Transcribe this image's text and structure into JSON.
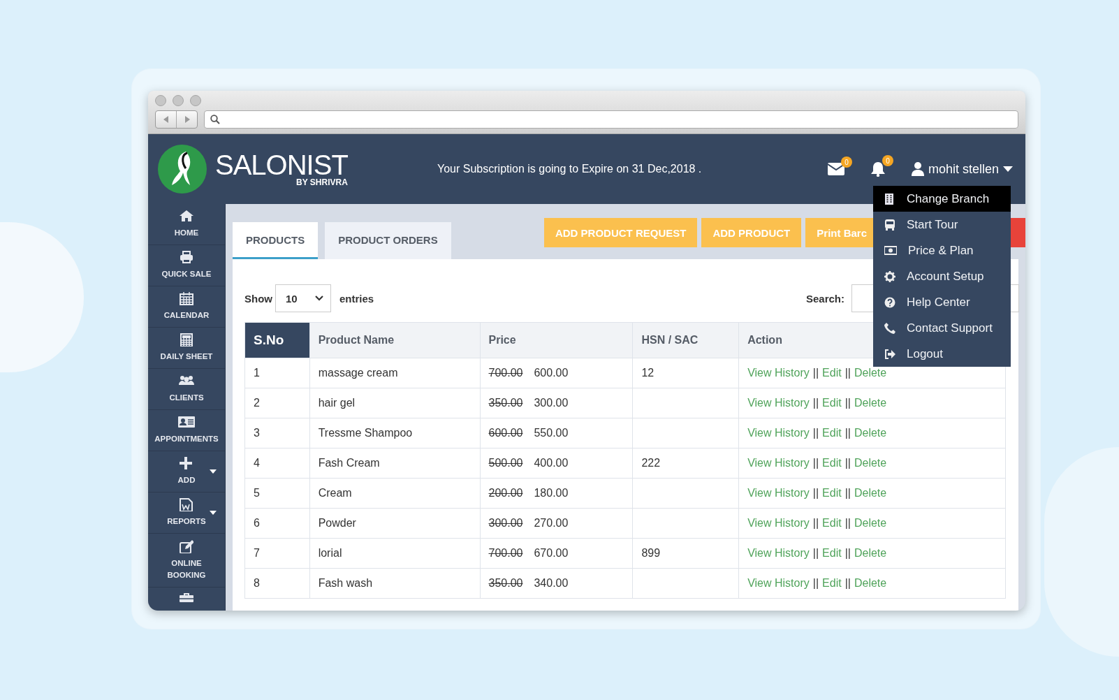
{
  "header": {
    "logo_name": "SALONIST",
    "logo_tagline": "BY SHRIVRA",
    "notice": "Your Subscription is going to Expire on 31 Dec,2018 .",
    "mail_count": "0",
    "alert_count": "0",
    "user": "mohit stellen"
  },
  "sidebar": {
    "items": [
      {
        "kind": "home",
        "label": "HOME",
        "has_caret": false
      },
      {
        "kind": "print",
        "label": "QUICK SALE",
        "has_caret": false
      },
      {
        "kind": "calendar",
        "label": "CALENDAR",
        "has_caret": false
      },
      {
        "kind": "sheet",
        "label": "DAILY SHEET",
        "has_caret": false
      },
      {
        "kind": "clients",
        "label": "CLIENTS",
        "has_caret": false
      },
      {
        "kind": "card",
        "label": "APPOINTMENTS",
        "has_caret": false
      },
      {
        "kind": "plus",
        "label": "ADD",
        "has_caret": true
      },
      {
        "kind": "document",
        "label": "REPORTS",
        "has_caret": true
      },
      {
        "kind": "edit",
        "label": "ONLINE BOOKING",
        "has_caret": false
      },
      {
        "kind": "briefcase",
        "has_caret": false
      }
    ]
  },
  "tabs": [
    {
      "label": "PRODUCTS",
      "selected": true
    },
    {
      "label": "PRODUCT ORDERS",
      "selected": false
    }
  ],
  "buttons": [
    {
      "kind": "warning",
      "label": "ADD PRODUCT REQUEST"
    },
    {
      "kind": "warning",
      "label": "ADD PRODUCT"
    },
    {
      "kind": "warning",
      "label": "Print Barc"
    },
    {
      "kind": "danger"
    }
  ],
  "table_controls": {
    "show_label": "Show",
    "page_size": "10",
    "entries_label": "entries",
    "search_label": "Search:"
  },
  "table": {
    "columns": [
      {
        "label": "S.No",
        "sorted": true
      },
      {
        "label": "Product Name",
        "sorted": false
      },
      {
        "label": "Price",
        "sorted": false
      },
      {
        "label": "HSN / SAC",
        "sorted": false
      },
      {
        "label": "Action",
        "sorted": false
      }
    ],
    "rows": [
      {
        "sno": "1",
        "name": "massage cream",
        "old_price": "700.00",
        "price": "600.00",
        "hsn": "12",
        "actions": [
          {
            "kind": "link",
            "label": "View History"
          },
          {
            "kind": "separator",
            "label": "||"
          },
          {
            "kind": "link",
            "label": "Edit"
          },
          {
            "kind": "separator",
            "label": "||"
          },
          {
            "kind": "link",
            "label": "Delete"
          }
        ]
      },
      {
        "sno": "2",
        "name": "hair gel",
        "old_price": "350.00",
        "price": "300.00",
        "actions": [
          {
            "kind": "link",
            "label": "View History"
          },
          {
            "kind": "separator",
            "label": "||"
          },
          {
            "kind": "link",
            "label": "Edit"
          },
          {
            "kind": "separator",
            "label": "||"
          },
          {
            "kind": "link",
            "label": "Delete"
          }
        ]
      },
      {
        "sno": "3",
        "name": "Tressme Shampoo",
        "old_price": "600.00",
        "price": "550.00",
        "actions": [
          {
            "kind": "link",
            "label": "View History"
          },
          {
            "kind": "separator",
            "label": "||"
          },
          {
            "kind": "link",
            "label": "Edit"
          },
          {
            "kind": "separator",
            "label": "||"
          },
          {
            "kind": "link",
            "label": "Delete"
          }
        ]
      },
      {
        "sno": "4",
        "name": "Fash Cream",
        "old_price": "500.00",
        "price": "400.00",
        "hsn": "222",
        "actions": [
          {
            "kind": "link",
            "label": "View History"
          },
          {
            "kind": "separator",
            "label": "||"
          },
          {
            "kind": "link",
            "label": "Edit"
          },
          {
            "kind": "separator",
            "label": "||"
          },
          {
            "kind": "link",
            "label": "Delete"
          }
        ]
      },
      {
        "sno": "5",
        "name": "Cream",
        "old_price": "200.00",
        "price": "180.00",
        "actions": [
          {
            "kind": "link",
            "label": "View History"
          },
          {
            "kind": "separator",
            "label": "||"
          },
          {
            "kind": "link",
            "label": "Edit"
          },
          {
            "kind": "separator",
            "label": "||"
          },
          {
            "kind": "link",
            "label": "Delete"
          }
        ]
      },
      {
        "sno": "6",
        "name": "Powder",
        "old_price": "300.00",
        "price": "270.00",
        "actions": [
          {
            "kind": "link",
            "label": "View History"
          },
          {
            "kind": "separator",
            "label": "||"
          },
          {
            "kind": "link",
            "label": "Edit"
          },
          {
            "kind": "separator",
            "label": "||"
          },
          {
            "kind": "link",
            "label": "Delete"
          }
        ]
      },
      {
        "sno": "7",
        "name": "lorial",
        "old_price": "700.00",
        "price": "670.00",
        "hsn": "899",
        "actions": [
          {
            "kind": "link",
            "label": "View History"
          },
          {
            "kind": "separator",
            "label": "||"
          },
          {
            "kind": "link",
            "label": "Edit"
          },
          {
            "kind": "separator",
            "label": "||"
          },
          {
            "kind": "link",
            "label": "Delete"
          }
        ]
      },
      {
        "sno": "8",
        "name": "Fash wash",
        "old_price": "350.00",
        "price": "340.00",
        "actions": [
          {
            "kind": "link",
            "label": "View History"
          },
          {
            "kind": "separator",
            "label": "||"
          },
          {
            "kind": "link",
            "label": "Edit"
          },
          {
            "kind": "separator",
            "label": "||"
          },
          {
            "kind": "link",
            "label": "Delete"
          }
        ]
      }
    ]
  },
  "user_menu": {
    "items": [
      {
        "kind": "branch",
        "label": "Change Branch",
        "selected": true
      },
      {
        "kind": "tour",
        "label": "Start Tour",
        "selected": false
      },
      {
        "kind": "price",
        "label": "Price & Plan",
        "selected": false
      },
      {
        "kind": "setup",
        "label": "Account Setup",
        "selected": false
      },
      {
        "kind": "help",
        "label": "Help Center",
        "selected": false
      },
      {
        "kind": "phone",
        "label": "Contact Support",
        "selected": false
      },
      {
        "kind": "logout",
        "label": "Logout",
        "selected": false
      }
    ]
  }
}
